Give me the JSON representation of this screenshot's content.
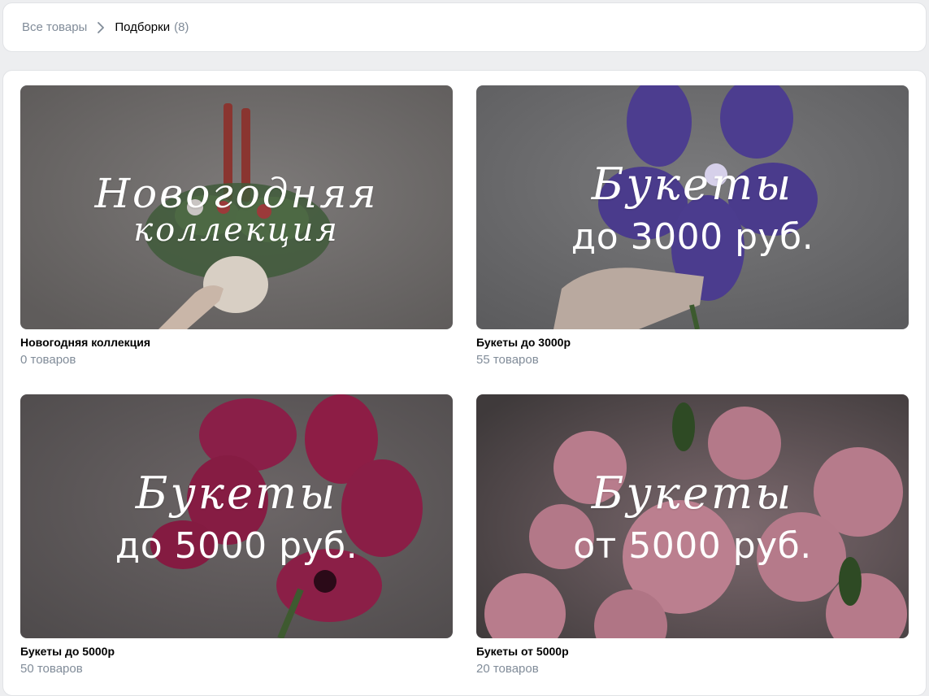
{
  "breadcrumb": {
    "all_goods": "Все товары",
    "current": "Подборки",
    "count": "(8)"
  },
  "albums": [
    {
      "cover_script_line1": "Новогодняя",
      "cover_script_line2": "коллекция",
      "cover_sub": "",
      "title": "Новогодняя коллекция",
      "count": "0 товаров"
    },
    {
      "cover_script_line1": "Букеты",
      "cover_sub": "до 3000 руб.",
      "title": "Букеты до 3000р",
      "count": "55 товаров"
    },
    {
      "cover_script_line1": "Букеты",
      "cover_sub": "до 5000 руб.",
      "title": "Букеты до 5000р",
      "count": "50 товаров"
    },
    {
      "cover_script_line1": "Букеты",
      "cover_sub": "от 5000 руб.",
      "title": "Букеты от 5000р",
      "count": "20 товаров"
    }
  ],
  "colors": {
    "page_bg": "#edeef0",
    "muted_text": "#818c99",
    "cover1_bg": "#6e6b6a",
    "cover2_bg": "#6a6a6c",
    "cover3_bg": "#5e5a5c",
    "cover4_bg": "#4a4647"
  }
}
